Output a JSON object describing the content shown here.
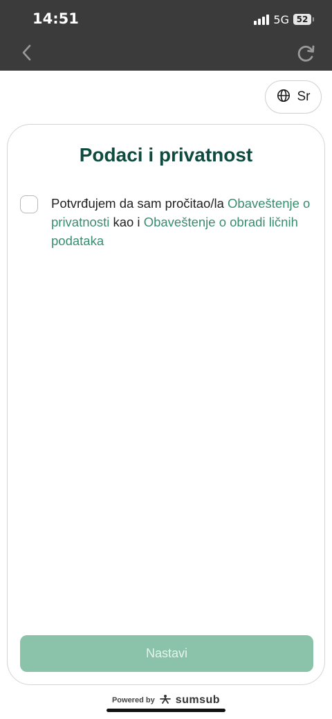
{
  "status_bar": {
    "time": "14:51",
    "network": "5G",
    "battery": "52"
  },
  "nav": {
    "back_icon": "chevron-left-icon",
    "reload_icon": "reload-icon"
  },
  "language": {
    "icon": "globe-icon",
    "label": "Sr"
  },
  "card": {
    "title": "Podaci i privatnost",
    "consent": {
      "text_before": "Potvrđujem da sam pročitao/la ",
      "link1": "Obaveštenje o privatnosti",
      "text_middle": " kao i ",
      "link2": "Obaveštenje o obradi ličnih podataka"
    },
    "continue_label": "Nastavi"
  },
  "footer": {
    "powered_label": "Powered by",
    "brand_label": "sumsub",
    "brand_icon": "sumsub-logo-icon"
  },
  "colors": {
    "top_bar": "#3b3b3b",
    "title": "#0f4a3f",
    "link": "#3a8c6f",
    "button_disabled": "#8bc3aa"
  }
}
